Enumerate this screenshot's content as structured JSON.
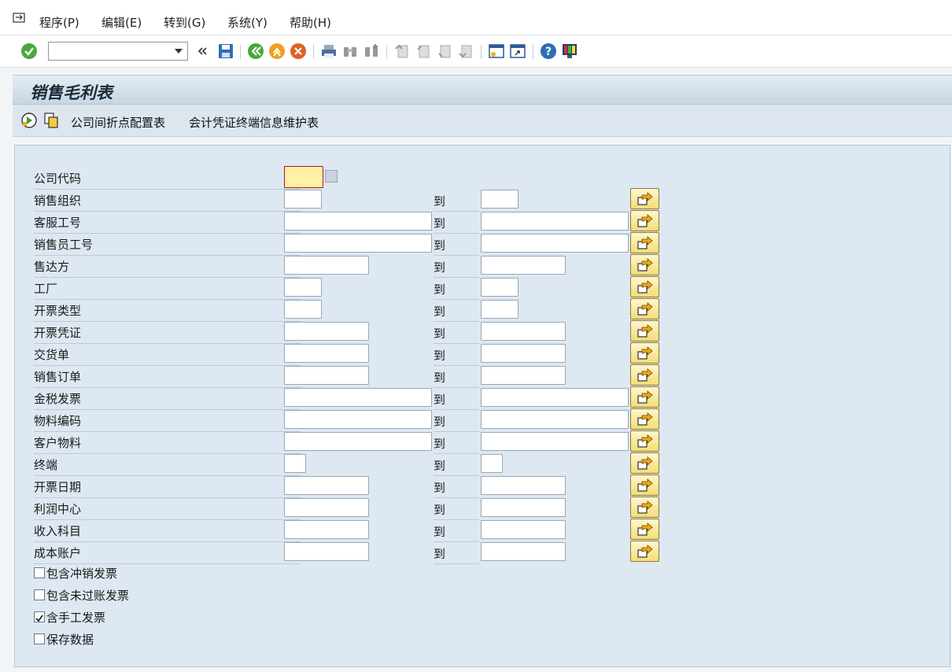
{
  "menu": {
    "items": [
      {
        "label": "程序(P)"
      },
      {
        "label": "编辑(E)"
      },
      {
        "label": "转到(G)"
      },
      {
        "label": "系统(Y)"
      },
      {
        "label": "帮助(H)"
      }
    ]
  },
  "toolbar": {
    "command_value": "",
    "icons": [
      "enter-icon",
      "back-icon",
      "save-icon",
      "green-back-icon",
      "exit-icon",
      "cancel-icon",
      "print-icon",
      "find-icon",
      "find-next-icon",
      "first-page-icon",
      "prev-page-icon",
      "next-page-icon",
      "last-page-icon",
      "create-session-icon",
      "shortcut-icon",
      "help-icon",
      "layout-icon"
    ]
  },
  "title": "销售毛利表",
  "app_toolbar": {
    "buttons": [
      "公司间折点配置表",
      "会计凭证终端信息维护表"
    ]
  },
  "form": {
    "to_label": "到",
    "fields": [
      {
        "label": "公司代码",
        "from": "",
        "to": null
      },
      {
        "label": "销售组织",
        "from": "",
        "to": ""
      },
      {
        "label": "客服工号",
        "from": "",
        "to": ""
      },
      {
        "label": "销售员工号",
        "from": "",
        "to": ""
      },
      {
        "label": "售达方",
        "from": "",
        "to": ""
      },
      {
        "label": "工厂",
        "from": "",
        "to": ""
      },
      {
        "label": "开票类型",
        "from": "",
        "to": ""
      },
      {
        "label": "开票凭证",
        "from": "",
        "to": ""
      },
      {
        "label": "交货单",
        "from": "",
        "to": ""
      },
      {
        "label": "销售订单",
        "from": "",
        "to": ""
      },
      {
        "label": "金税发票",
        "from": "",
        "to": ""
      },
      {
        "label": "物料编码",
        "from": "",
        "to": ""
      },
      {
        "label": "客户物料",
        "from": "",
        "to": ""
      },
      {
        "label": "终端",
        "from": "",
        "to": ""
      },
      {
        "label": "开票日期",
        "from": "",
        "to": ""
      },
      {
        "label": "利润中心",
        "from": "",
        "to": ""
      },
      {
        "label": "收入科目",
        "from": "",
        "to": ""
      },
      {
        "label": "成本账户",
        "from": "",
        "to": ""
      }
    ],
    "checkboxes": [
      {
        "label": "包含冲销发票",
        "checked": false
      },
      {
        "label": "包含未过账发票",
        "checked": false
      },
      {
        "label": "含手工发票",
        "checked": true
      },
      {
        "label": "保存数据",
        "checked": false
      }
    ]
  },
  "colors": {
    "required_field_bg": "#fff1a8",
    "form_bg": "#dde8f2",
    "multi_select_btn": "#f5dc73"
  }
}
